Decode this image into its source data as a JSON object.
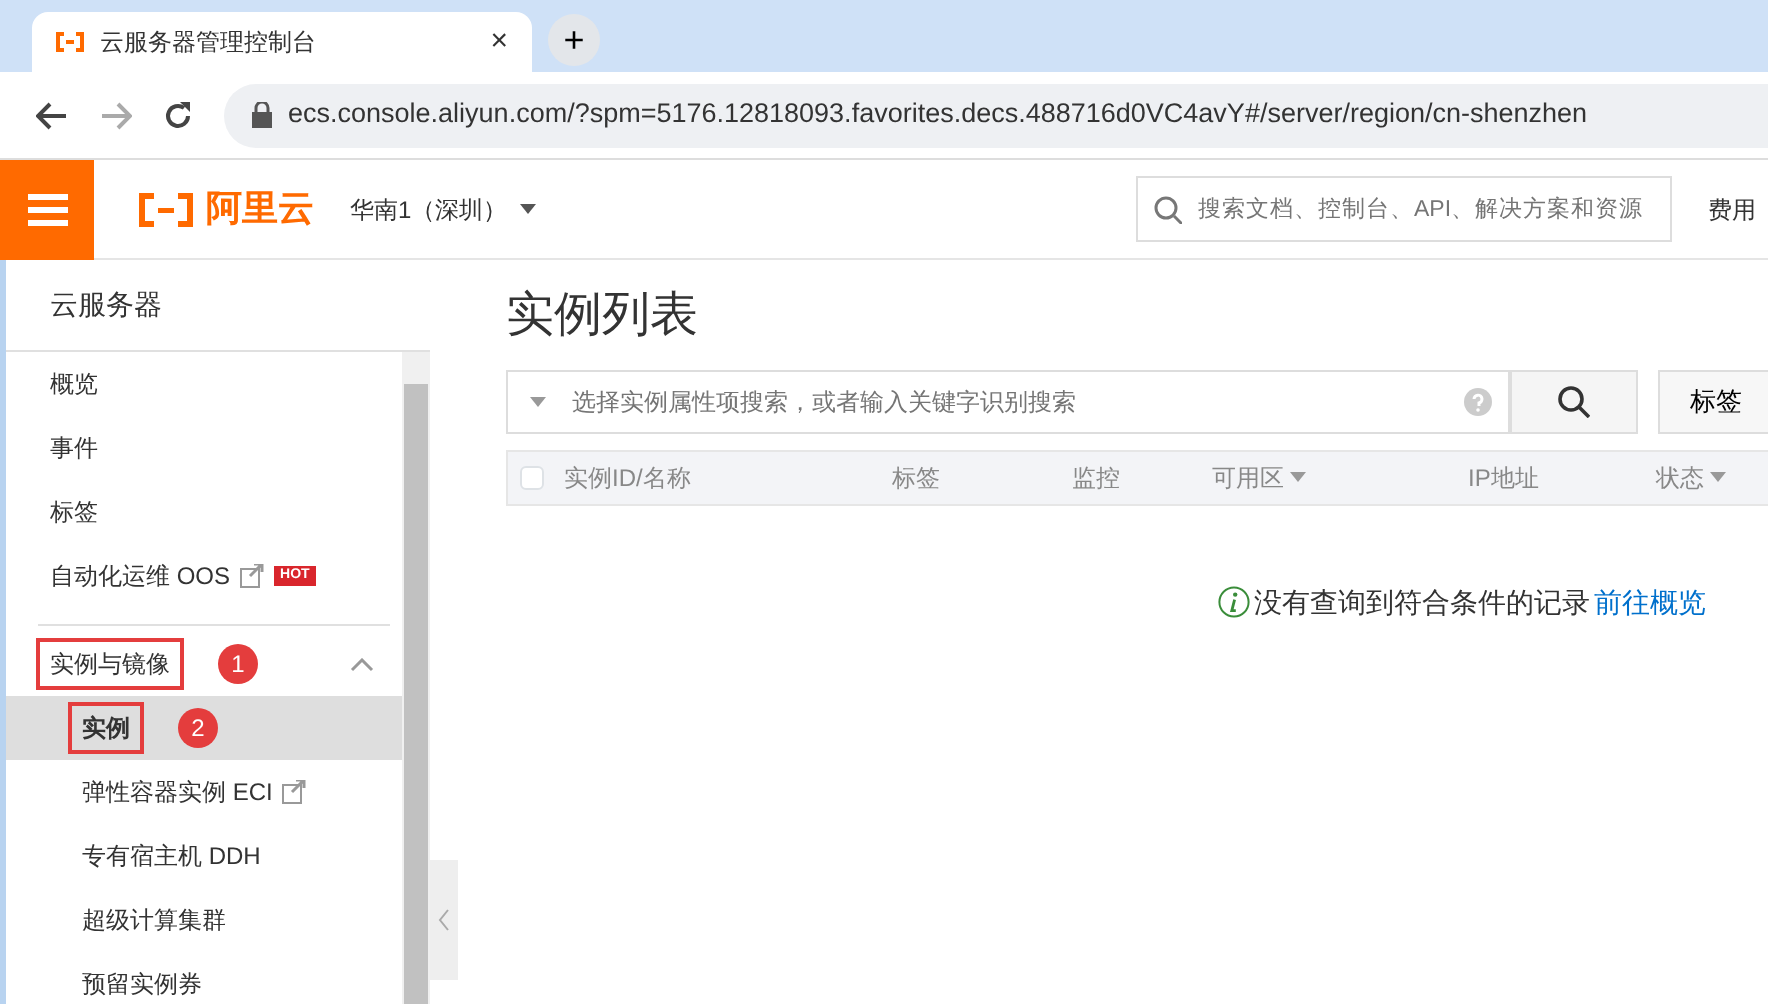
{
  "browser": {
    "tab_title": "云服务器管理控制台",
    "new_tab": "+",
    "close": "×",
    "url": "ecs.console.aliyun.com/?spm=5176.12818093.favorites.decs.488716d0VC4avY#/server/region/cn-shenzhen"
  },
  "header": {
    "logo": "阿里云",
    "region": "华南1（深圳）",
    "search_placeholder": "搜索文档、控制台、API、解决方案和资源",
    "right_link": "费用"
  },
  "sidebar": {
    "title": "云服务器",
    "items": [
      {
        "kind": "item",
        "label": "概览",
        "selected": false
      },
      {
        "kind": "item",
        "label": "事件",
        "selected": false
      },
      {
        "kind": "item",
        "label": "标签",
        "selected": false
      },
      {
        "kind": "item",
        "label": "自动化运维 OOS",
        "external": true,
        "badge": "HOT",
        "selected": false
      },
      {
        "kind": "section",
        "label": "实例与镜像",
        "expanded": true,
        "highlighted": true,
        "marker": "1",
        "children": [
          {
            "label": "实例",
            "selected": true,
            "highlighted": true,
            "marker": "2"
          },
          {
            "label": "弹性容器实例 ECI",
            "external": true,
            "selected": false
          },
          {
            "label": "专有宿主机 DDH",
            "selected": false
          },
          {
            "label": "超级计算集群",
            "selected": false
          },
          {
            "label": "预留实例券",
            "selected": false
          }
        ]
      }
    ]
  },
  "main": {
    "title": "实例列表",
    "filter_placeholder": "选择实例属性项搜索，或者输入关键字识别搜索",
    "tag_button": "标签",
    "columns": [
      {
        "label": "实例ID/名称",
        "sortable": false
      },
      {
        "label": "标签",
        "sortable": false
      },
      {
        "label": "监控",
        "sortable": false
      },
      {
        "label": "可用区",
        "sortable": true
      },
      {
        "label": "IP地址",
        "sortable": false
      },
      {
        "label": "状态",
        "sortable": true
      }
    ],
    "select_all_checked": false,
    "empty_message": "没有查询到符合条件的记录",
    "empty_link": "前往概览"
  }
}
